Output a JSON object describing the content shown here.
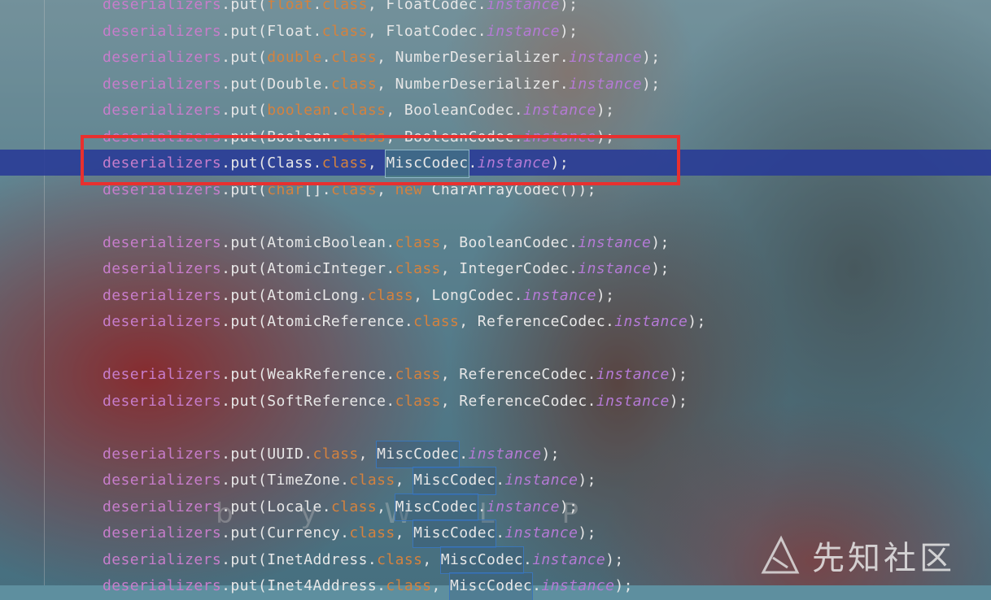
{
  "colors": {
    "variable": "#c77dcb",
    "keyword": "#d4823e",
    "italic_field": "#b57ad6",
    "plain": "#e7e7e7",
    "highlight_band": "#283a96",
    "annotation_box": "#e8302f"
  },
  "code_lines": [
    [
      {
        "t": "deserializers",
        "c": "var"
      },
      {
        "t": ".put(",
        "c": "plain"
      },
      {
        "t": "float",
        "c": "kw"
      },
      {
        "t": ".",
        "c": "plain"
      },
      {
        "t": "class",
        "c": "kw"
      },
      {
        "t": ", FloatCodec.",
        "c": "plain"
      },
      {
        "t": "instance",
        "c": "inst"
      },
      {
        "t": ");",
        "c": "plain"
      }
    ],
    [
      {
        "t": "deserializers",
        "c": "var"
      },
      {
        "t": ".put(Float.",
        "c": "plain"
      },
      {
        "t": "class",
        "c": "kw"
      },
      {
        "t": ", FloatCodec.",
        "c": "plain"
      },
      {
        "t": "instance",
        "c": "inst"
      },
      {
        "t": ");",
        "c": "plain"
      }
    ],
    [
      {
        "t": "deserializers",
        "c": "var"
      },
      {
        "t": ".put(",
        "c": "plain"
      },
      {
        "t": "double",
        "c": "kw"
      },
      {
        "t": ".",
        "c": "plain"
      },
      {
        "t": "class",
        "c": "kw"
      },
      {
        "t": ", NumberDeserializer.",
        "c": "plain"
      },
      {
        "t": "instance",
        "c": "inst"
      },
      {
        "t": ");",
        "c": "plain"
      }
    ],
    [
      {
        "t": "deserializers",
        "c": "var"
      },
      {
        "t": ".put(Double.",
        "c": "plain"
      },
      {
        "t": "class",
        "c": "kw"
      },
      {
        "t": ", NumberDeserializer.",
        "c": "plain"
      },
      {
        "t": "instance",
        "c": "inst"
      },
      {
        "t": ");",
        "c": "plain"
      }
    ],
    [
      {
        "t": "deserializers",
        "c": "var"
      },
      {
        "t": ".put(",
        "c": "plain"
      },
      {
        "t": "boolean",
        "c": "kw"
      },
      {
        "t": ".",
        "c": "plain"
      },
      {
        "t": "class",
        "c": "kw"
      },
      {
        "t": ", BooleanCodec.",
        "c": "plain"
      },
      {
        "t": "instance",
        "c": "inst"
      },
      {
        "t": ");",
        "c": "plain"
      }
    ],
    [
      {
        "t": "deserializers",
        "c": "var"
      },
      {
        "t": ".put(Boolean.",
        "c": "plain"
      },
      {
        "t": "class",
        "c": "kw"
      },
      {
        "t": ", BooleanCodec.",
        "c": "plain"
      },
      {
        "t": "instance",
        "c": "inst"
      },
      {
        "t": ");",
        "c": "plain"
      }
    ],
    [
      {
        "t": "deserializers",
        "c": "var"
      },
      {
        "t": ".put(Class.",
        "c": "plain"
      },
      {
        "t": "class",
        "c": "kw"
      },
      {
        "t": ", ",
        "c": "plain"
      },
      {
        "t": "MiscCodec",
        "c": "refsel"
      },
      {
        "t": ".",
        "c": "plain"
      },
      {
        "t": "instance",
        "c": "inst"
      },
      {
        "t": ");",
        "c": "plain"
      }
    ],
    [
      {
        "t": "deserializers",
        "c": "var"
      },
      {
        "t": ".put(",
        "c": "plain"
      },
      {
        "t": "char",
        "c": "kw"
      },
      {
        "t": "[].",
        "c": "plain"
      },
      {
        "t": "class",
        "c": "kw"
      },
      {
        "t": ", ",
        "c": "plain"
      },
      {
        "t": "new",
        "c": "kw"
      },
      {
        "t": " CharArrayCodec());",
        "c": "plain"
      }
    ],
    [],
    [
      {
        "t": "deserializers",
        "c": "var"
      },
      {
        "t": ".put(AtomicBoolean.",
        "c": "plain"
      },
      {
        "t": "class",
        "c": "kw"
      },
      {
        "t": ", BooleanCodec.",
        "c": "plain"
      },
      {
        "t": "instance",
        "c": "inst"
      },
      {
        "t": ");",
        "c": "plain"
      }
    ],
    [
      {
        "t": "deserializers",
        "c": "var"
      },
      {
        "t": ".put(AtomicInteger.",
        "c": "plain"
      },
      {
        "t": "class",
        "c": "kw"
      },
      {
        "t": ", IntegerCodec.",
        "c": "plain"
      },
      {
        "t": "instance",
        "c": "inst"
      },
      {
        "t": ");",
        "c": "plain"
      }
    ],
    [
      {
        "t": "deserializers",
        "c": "var"
      },
      {
        "t": ".put(AtomicLong.",
        "c": "plain"
      },
      {
        "t": "class",
        "c": "kw"
      },
      {
        "t": ", LongCodec.",
        "c": "plain"
      },
      {
        "t": "instance",
        "c": "inst"
      },
      {
        "t": ");",
        "c": "plain"
      }
    ],
    [
      {
        "t": "deserializers",
        "c": "var"
      },
      {
        "t": ".put(AtomicReference.",
        "c": "plain"
      },
      {
        "t": "class",
        "c": "kw"
      },
      {
        "t": ", ReferenceCodec.",
        "c": "plain"
      },
      {
        "t": "instance",
        "c": "inst"
      },
      {
        "t": ");",
        "c": "plain"
      }
    ],
    [],
    [
      {
        "t": "deserializers",
        "c": "var"
      },
      {
        "t": ".put(WeakReference.",
        "c": "plain"
      },
      {
        "t": "class",
        "c": "kw"
      },
      {
        "t": ", ReferenceCodec.",
        "c": "plain"
      },
      {
        "t": "instance",
        "c": "inst"
      },
      {
        "t": ");",
        "c": "plain"
      }
    ],
    [
      {
        "t": "deserializers",
        "c": "var"
      },
      {
        "t": ".put(SoftReference.",
        "c": "plain"
      },
      {
        "t": "class",
        "c": "kw"
      },
      {
        "t": ", ReferenceCodec.",
        "c": "plain"
      },
      {
        "t": "instance",
        "c": "inst"
      },
      {
        "t": ");",
        "c": "plain"
      }
    ],
    [],
    [
      {
        "t": "deserializers",
        "c": "var"
      },
      {
        "t": ".put(UUID.",
        "c": "plain"
      },
      {
        "t": "class",
        "c": "kw"
      },
      {
        "t": ", ",
        "c": "plain"
      },
      {
        "t": "MiscCodec",
        "c": "ref"
      },
      {
        "t": ".",
        "c": "plain"
      },
      {
        "t": "instance",
        "c": "inst"
      },
      {
        "t": ");",
        "c": "plain"
      }
    ],
    [
      {
        "t": "deserializers",
        "c": "var"
      },
      {
        "t": ".put(TimeZone.",
        "c": "plain"
      },
      {
        "t": "class",
        "c": "kw"
      },
      {
        "t": ", ",
        "c": "plain"
      },
      {
        "t": "MiscCodec",
        "c": "ref"
      },
      {
        "t": ".",
        "c": "plain"
      },
      {
        "t": "instance",
        "c": "inst"
      },
      {
        "t": ");",
        "c": "plain"
      }
    ],
    [
      {
        "t": "deserializers",
        "c": "var"
      },
      {
        "t": ".put(Locale.",
        "c": "plain"
      },
      {
        "t": "class",
        "c": "kw"
      },
      {
        "t": ", ",
        "c": "plain"
      },
      {
        "t": "MiscCodec",
        "c": "ref"
      },
      {
        "t": ".",
        "c": "plain"
      },
      {
        "t": "instance",
        "c": "inst"
      },
      {
        "t": ");",
        "c": "plain"
      }
    ],
    [
      {
        "t": "deserializers",
        "c": "var"
      },
      {
        "t": ".put(Currency.",
        "c": "plain"
      },
      {
        "t": "class",
        "c": "kw"
      },
      {
        "t": ", ",
        "c": "plain"
      },
      {
        "t": "MiscCodec",
        "c": "ref"
      },
      {
        "t": ".",
        "c": "plain"
      },
      {
        "t": "instance",
        "c": "inst"
      },
      {
        "t": ");",
        "c": "plain"
      }
    ],
    [
      {
        "t": "deserializers",
        "c": "var"
      },
      {
        "t": ".put(InetAddress.",
        "c": "plain"
      },
      {
        "t": "class",
        "c": "kw"
      },
      {
        "t": ", ",
        "c": "plain"
      },
      {
        "t": "MiscCodec",
        "c": "ref"
      },
      {
        "t": ".",
        "c": "plain"
      },
      {
        "t": "instance",
        "c": "inst"
      },
      {
        "t": ");",
        "c": "plain"
      }
    ],
    [
      {
        "t": "deserializers",
        "c": "var"
      },
      {
        "t": ".put(Inet4Address.",
        "c": "plain"
      },
      {
        "t": "class",
        "c": "kw"
      },
      {
        "t": ", ",
        "c": "plain"
      },
      {
        "t": "MiscCodec",
        "c": "ref"
      },
      {
        "t": ".",
        "c": "plain"
      },
      {
        "t": "instance",
        "c": "inst"
      },
      {
        "t": ");",
        "c": "plain"
      }
    ]
  ],
  "background_text": "b y W L P",
  "watermark": {
    "text": "先知社区",
    "icon": "xianzhi-logo-icon"
  }
}
